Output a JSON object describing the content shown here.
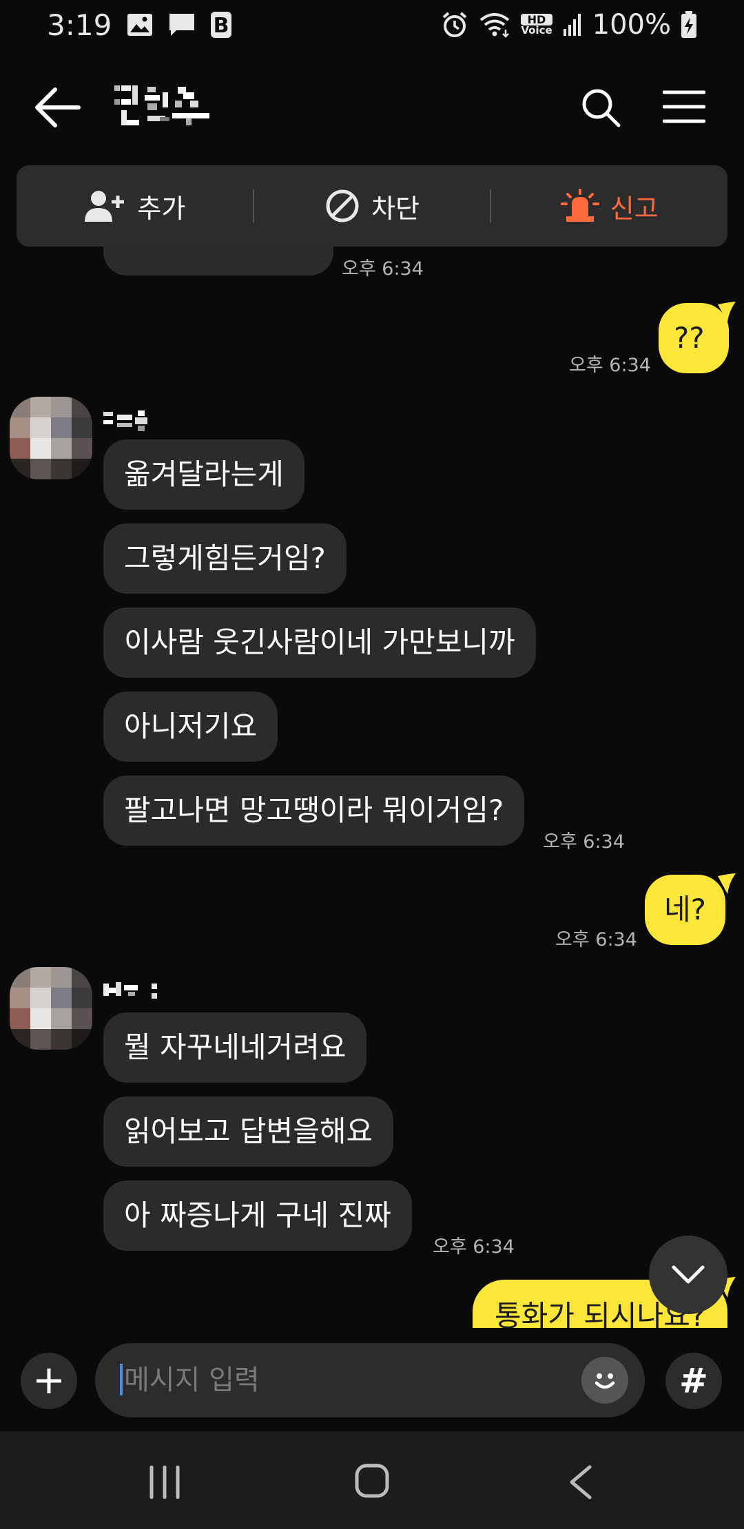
{
  "status_bar": {
    "time": "3:19",
    "battery_percent": "100%",
    "hd_label": "HD",
    "voice_label": "Voice",
    "notification_letter": "B",
    "left_icons": [
      "image-icon",
      "chat-icon",
      "b-app-icon"
    ],
    "right_icons": [
      "alarm-icon",
      "wifi-icon",
      "hd-voice-icon",
      "signal-icon",
      "battery-charging-icon"
    ]
  },
  "header": {
    "title_icon": "pixelated-name",
    "back_icon": "arrow-left-icon",
    "search_icon": "search-icon",
    "menu_icon": "hamburger-menu-icon"
  },
  "action_bar": {
    "add_label": "추가",
    "block_label": "차단",
    "report_label": "신고",
    "report_color": "#ff6a3d"
  },
  "messages": {
    "partial_time": "오후 6:34",
    "m1_text": "??",
    "m1_time": "오후 6:34",
    "g1_lines": [
      "옮겨달라는게",
      "그렇게힘든거임?",
      "이사람 웃긴사람이네 가만보니까",
      "아니저기요",
      "팔고나면 망고땡이라 뭐이거임?"
    ],
    "g1_time": "오후 6:34",
    "m2_text": "네?",
    "m2_time": "오후 6:34",
    "g2_lines": [
      "뭘 자꾸네네거려요",
      "읽어보고 답변을해요",
      "아 짜증나게 구네 진짜"
    ],
    "g2_time": "오후 6:34",
    "m3_text": "통화가 되시나요?",
    "my_bubble_color": "#fde63a",
    "other_bubble_color": "#2b2b2b"
  },
  "input": {
    "placeholder": "메시지 입력",
    "hash_label": "#"
  }
}
